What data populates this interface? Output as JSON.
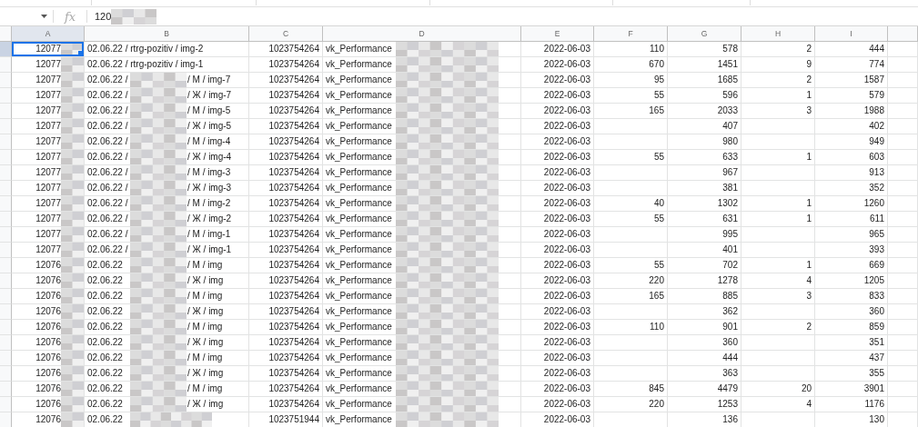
{
  "formula_bar": {
    "function_label": "fx",
    "value": "120"
  },
  "columns": [
    "A",
    "B",
    "C",
    "D",
    "E",
    "F",
    "G",
    "H",
    "I"
  ],
  "rows": [
    {
      "selected": true,
      "a": "12077",
      "b": "02.06.22 / rtrg-pozitiv / img-2",
      "c": "1023754264",
      "d": "vk_Performance",
      "e": "2022-06-03",
      "f": "110",
      "g": "578",
      "h": "2",
      "i": "444"
    },
    {
      "selected": false,
      "a": "12077",
      "b": "02.06.22 / rtrg-pozitiv / img-1",
      "c": "1023754264",
      "d": "vk_Performance",
      "e": "2022-06-03",
      "f": "670",
      "g": "1451",
      "h": "9",
      "i": "774"
    },
    {
      "selected": false,
      "a": "12077",
      "b_start": "02.06.22 /",
      "b_end": "/ M / img-7",
      "c": "1023754264",
      "d": "vk_Performance",
      "e": "2022-06-03",
      "f": "95",
      "g": "1685",
      "h": "2",
      "i": "1587"
    },
    {
      "selected": false,
      "a": "12077",
      "b_start": "02.06.22 /",
      "b_end": "/ Ж / img-7",
      "c": "1023754264",
      "d": "vk_Performance",
      "e": "2022-06-03",
      "f": "55",
      "g": "596",
      "h": "1",
      "i": "579"
    },
    {
      "selected": false,
      "a": "12077",
      "b_start": "02.06.22 /",
      "b_end": "/ M / img-5",
      "c": "1023754264",
      "d": "vk_Performance",
      "e": "2022-06-03",
      "f": "165",
      "g": "2033",
      "h": "3",
      "i": "1988"
    },
    {
      "selected": false,
      "a": "12077",
      "b_start": "02.06.22 /",
      "b_end": "/ Ж / img-5",
      "c": "1023754264",
      "d": "vk_Performance",
      "e": "2022-06-03",
      "g": "407",
      "i": "402"
    },
    {
      "selected": false,
      "a": "12077",
      "b_start": "02.06.22 /",
      "b_end": "/ M / img-4",
      "c": "1023754264",
      "d": "vk_Performance",
      "e": "2022-06-03",
      "g": "980",
      "i": "949"
    },
    {
      "selected": false,
      "a": "12077",
      "b_start": "02.06.22 /",
      "b_end": "/ Ж / img-4",
      "c": "1023754264",
      "d": "vk_Performance",
      "e": "2022-06-03",
      "f": "55",
      "g": "633",
      "h": "1",
      "i": "603"
    },
    {
      "selected": false,
      "a": "12077",
      "b_start": "02.06.22 /",
      "b_end": "/ M / img-3",
      "c": "1023754264",
      "d": "vk_Performance",
      "e": "2022-06-03",
      "g": "967",
      "i": "913"
    },
    {
      "selected": false,
      "a": "12077",
      "b_start": "02.06.22 /",
      "b_end": "/ Ж / img-3",
      "c": "1023754264",
      "d": "vk_Performance",
      "e": "2022-06-03",
      "g": "381",
      "i": "352"
    },
    {
      "selected": false,
      "a": "12077",
      "b_start": "02.06.22 /",
      "b_end": "/ M / img-2",
      "c": "1023754264",
      "d": "vk_Performance",
      "e": "2022-06-03",
      "f": "40",
      "g": "1302",
      "h": "1",
      "i": "1260"
    },
    {
      "selected": false,
      "a": "12077",
      "b_start": "02.06.22 /",
      "b_end": "/ Ж / img-2",
      "c": "1023754264",
      "d": "vk_Performance",
      "e": "2022-06-03",
      "f": "55",
      "g": "631",
      "h": "1",
      "i": "611"
    },
    {
      "selected": false,
      "a": "12077",
      "b_start": "02.06.22 /",
      "b_end": "/ M / img-1",
      "c": "1023754264",
      "d": "vk_Performance",
      "e": "2022-06-03",
      "g": "995",
      "i": "965"
    },
    {
      "selected": false,
      "a": "12077",
      "b_start": "02.06.22 /",
      "b_end": "/ Ж / img-1",
      "c": "1023754264",
      "d": "vk_Performance",
      "e": "2022-06-03",
      "g": "401",
      "i": "393"
    },
    {
      "selected": false,
      "a": "12076",
      "b_start": "02.06.22",
      "b_end": "/ M / img",
      "c": "1023754264",
      "d": "vk_Performance",
      "e": "2022-06-03",
      "f": "55",
      "g": "702",
      "h": "1",
      "i": "669"
    },
    {
      "selected": false,
      "a": "12076",
      "b_start": "02.06.22",
      "b_end": "/ Ж / img",
      "c": "1023754264",
      "d": "vk_Performance",
      "e": "2022-06-03",
      "f": "220",
      "g": "1278",
      "h": "4",
      "i": "1205"
    },
    {
      "selected": false,
      "a": "12076",
      "b_start": "02.06.22",
      "b_end": "/ M / img",
      "c": "1023754264",
      "d": "vk_Performance",
      "e": "2022-06-03",
      "f": "165",
      "g": "885",
      "h": "3",
      "i": "833"
    },
    {
      "selected": false,
      "a": "12076",
      "b_start": "02.06.22",
      "b_end": "/ Ж / img",
      "c": "1023754264",
      "d": "vk_Performance",
      "e": "2022-06-03",
      "g": "362",
      "i": "360"
    },
    {
      "selected": false,
      "a": "12076",
      "b_start": "02.06.22",
      "b_end": "/ M / img",
      "c": "1023754264",
      "d": "vk_Performance",
      "e": "2022-06-03",
      "f": "110",
      "g": "901",
      "h": "2",
      "i": "859"
    },
    {
      "selected": false,
      "a": "12076",
      "b_start": "02.06.22",
      "b_end": "/ Ж / img",
      "c": "1023754264",
      "d": "vk_Performance",
      "e": "2022-06-03",
      "g": "360",
      "i": "351"
    },
    {
      "selected": false,
      "a": "12076",
      "b_start": "02.06.22",
      "b_end": "/ M / img",
      "c": "1023754264",
      "d": "vk_Performance",
      "e": "2022-06-03",
      "g": "444",
      "i": "437"
    },
    {
      "selected": false,
      "a": "12076",
      "b_start": "02.06.22",
      "b_end": "/ Ж / img",
      "c": "1023754264",
      "d": "vk_Performance",
      "e": "2022-06-03",
      "g": "363",
      "i": "355"
    },
    {
      "selected": false,
      "a": "12076",
      "b_start": "02.06.22",
      "b_end": "/ M / img",
      "c": "1023754264",
      "d": "vk_Performance",
      "e": "2022-06-03",
      "f": "845",
      "g": "4479",
      "h": "20",
      "i": "3901"
    },
    {
      "selected": false,
      "a": "12076",
      "b_start": "02.06.22",
      "b_end": "/ Ж / img",
      "c": "1023754264",
      "d": "vk_Performance",
      "e": "2022-06-03",
      "f": "220",
      "g": "1253",
      "h": "4",
      "i": "1176"
    },
    {
      "selected": false,
      "a": "12076",
      "b_start": "02.06.22",
      "c": "1023751944",
      "d": "vk_Performance",
      "e": "2022-06-03",
      "g": "136",
      "i": "130"
    }
  ]
}
